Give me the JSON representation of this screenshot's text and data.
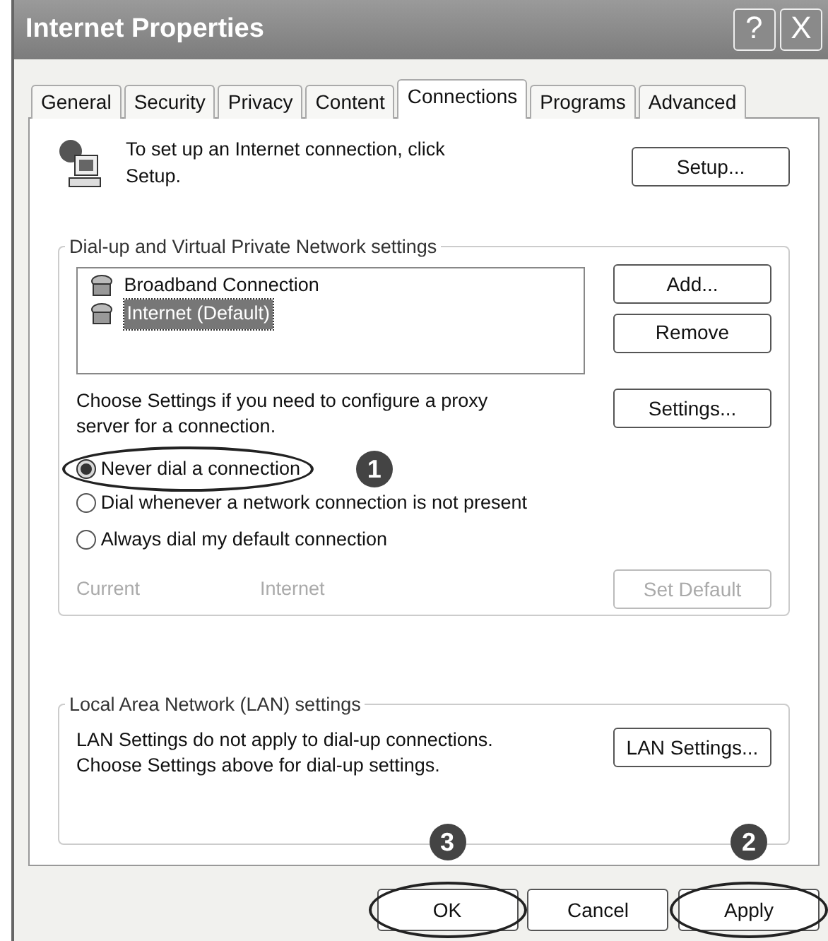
{
  "window": {
    "title": "Internet Properties",
    "title_buttons": [
      "?",
      "X"
    ]
  },
  "tabs": [
    {
      "label": "General",
      "selected": false
    },
    {
      "label": "Security",
      "selected": false
    },
    {
      "label": "Privacy",
      "selected": false
    },
    {
      "label": "Content",
      "selected": false
    },
    {
      "label": "Connections",
      "selected": true
    },
    {
      "label": "Programs",
      "selected": false
    },
    {
      "label": "Advanced",
      "selected": false
    }
  ],
  "setup": {
    "text": "To set up an Internet connection, click Setup.",
    "button": "Setup..."
  },
  "dialup": {
    "legend": "Dial-up and Virtual Private Network settings",
    "connections": [
      {
        "name": "Broadband Connection",
        "selected": false
      },
      {
        "name": "Internet (Default)",
        "selected": true
      }
    ],
    "side_buttons": [
      {
        "label": "Add...",
        "disabled": false
      },
      {
        "label": "Remove",
        "disabled": false
      }
    ],
    "proxy_text": "Choose Settings if you need to configure a proxy server for a connection.",
    "settings_button": "Settings...",
    "options": [
      {
        "label": "Never dial a connection",
        "selected": true,
        "circled": true,
        "step": "1"
      },
      {
        "label": "Dial whenever a network connection is not present",
        "selected": false,
        "circled": false
      },
      {
        "label": "Always dial my default connection",
        "selected": false,
        "circled": false
      }
    ],
    "current": {
      "label": "Current",
      "value": "Internet",
      "button": "Set Default",
      "disabled": true
    }
  },
  "lan": {
    "legend": "Local Area Network (LAN) settings",
    "text": "LAN Settings do not apply to dial-up connections. Choose Settings above for dial-up settings.",
    "button": "LAN Settings..."
  },
  "buttons": [
    {
      "label": "OK",
      "circled": true,
      "step": "3"
    },
    {
      "label": "Cancel",
      "circled": false
    },
    {
      "label": "Apply",
      "circled": true,
      "step": "2"
    }
  ]
}
